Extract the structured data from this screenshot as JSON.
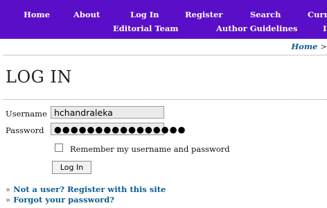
{
  "nav": {
    "row1": [
      "Home",
      "About",
      "Log In",
      "Register",
      "Search",
      "Curr"
    ],
    "row2": [
      "Editorial Team",
      "Author Guidelines",
      "I"
    ]
  },
  "breadcrumb": {
    "home": "Home",
    "separator": ">"
  },
  "page": {
    "title": "LOG IN"
  },
  "form": {
    "username_label": "Username",
    "username_value": "hchandraleka",
    "password_label": "Password",
    "password_value": "●●●●●●●●●●●●●●●●",
    "remember_label": "Remember my username and password",
    "remember_checked": false,
    "submit_label": "Log In"
  },
  "links": {
    "arrow": "»",
    "register": "Not a user? Register with this site",
    "forgot": "Forgot your password?"
  },
  "colors": {
    "navbar": "#5b0ec7",
    "link": "#0b5d91"
  }
}
